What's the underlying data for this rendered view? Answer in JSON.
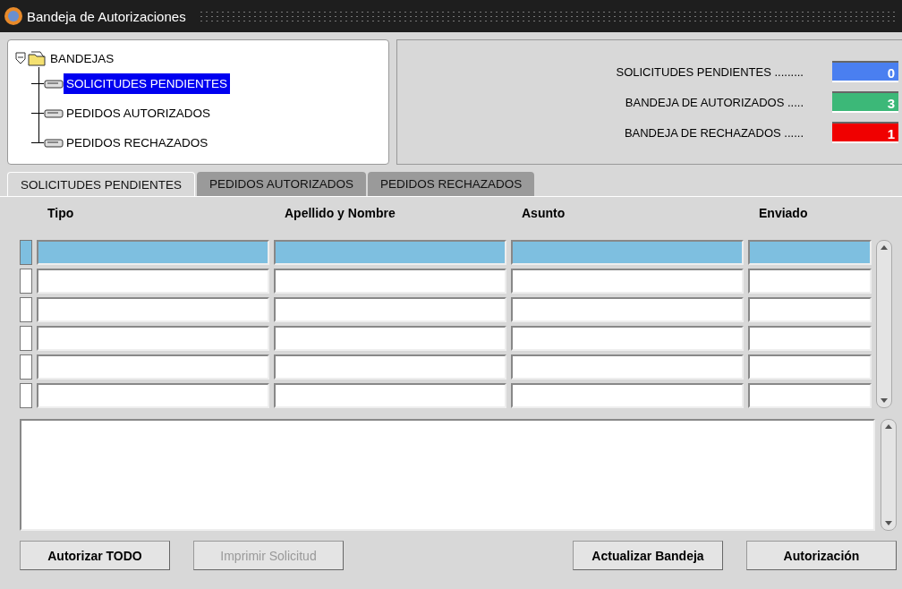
{
  "window": {
    "title": "Bandeja de Autorizaciones"
  },
  "tree": {
    "label": "BANDEJAS",
    "expanded": true,
    "children": [
      {
        "label": "SOLICITUDES PENDIENTES",
        "selected": true
      },
      {
        "label": "PEDIDOS AUTORIZADOS",
        "selected": false
      },
      {
        "label": "PEDIDOS RECHAZADOS",
        "selected": false
      }
    ]
  },
  "counters": [
    {
      "label": "SOLICITUDES PENDIENTES .........",
      "value": "0",
      "color": "#4a7ff0"
    },
    {
      "label": "BANDEJA DE AUTORIZADOS .....",
      "value": "3",
      "color": "#3cb878"
    },
    {
      "label": "BANDEJA DE RECHAZADOS ......",
      "value": "1",
      "color": "#f00000"
    }
  ],
  "tabs": [
    {
      "label": "SOLICITUDES PENDIENTES",
      "selected": true
    },
    {
      "label": "PEDIDOS AUTORIZADOS",
      "selected": false
    },
    {
      "label": "PEDIDOS RECHAZADOS",
      "selected": false
    }
  ],
  "table": {
    "columns": [
      "Tipo",
      "Apellido y Nombre",
      "Asunto",
      "Enviado"
    ],
    "rows": [
      {
        "selected": true
      },
      {
        "selected": false
      },
      {
        "selected": false
      },
      {
        "selected": false
      },
      {
        "selected": false
      },
      {
        "selected": false
      }
    ]
  },
  "buttons": [
    {
      "label": "Autorizar TODO",
      "disabled": false
    },
    {
      "label": "Imprimir Solicitud",
      "disabled": true
    },
    {
      "label": "Actualizar Bandeja",
      "disabled": false
    },
    {
      "label": "Autorización",
      "disabled": false
    }
  ]
}
